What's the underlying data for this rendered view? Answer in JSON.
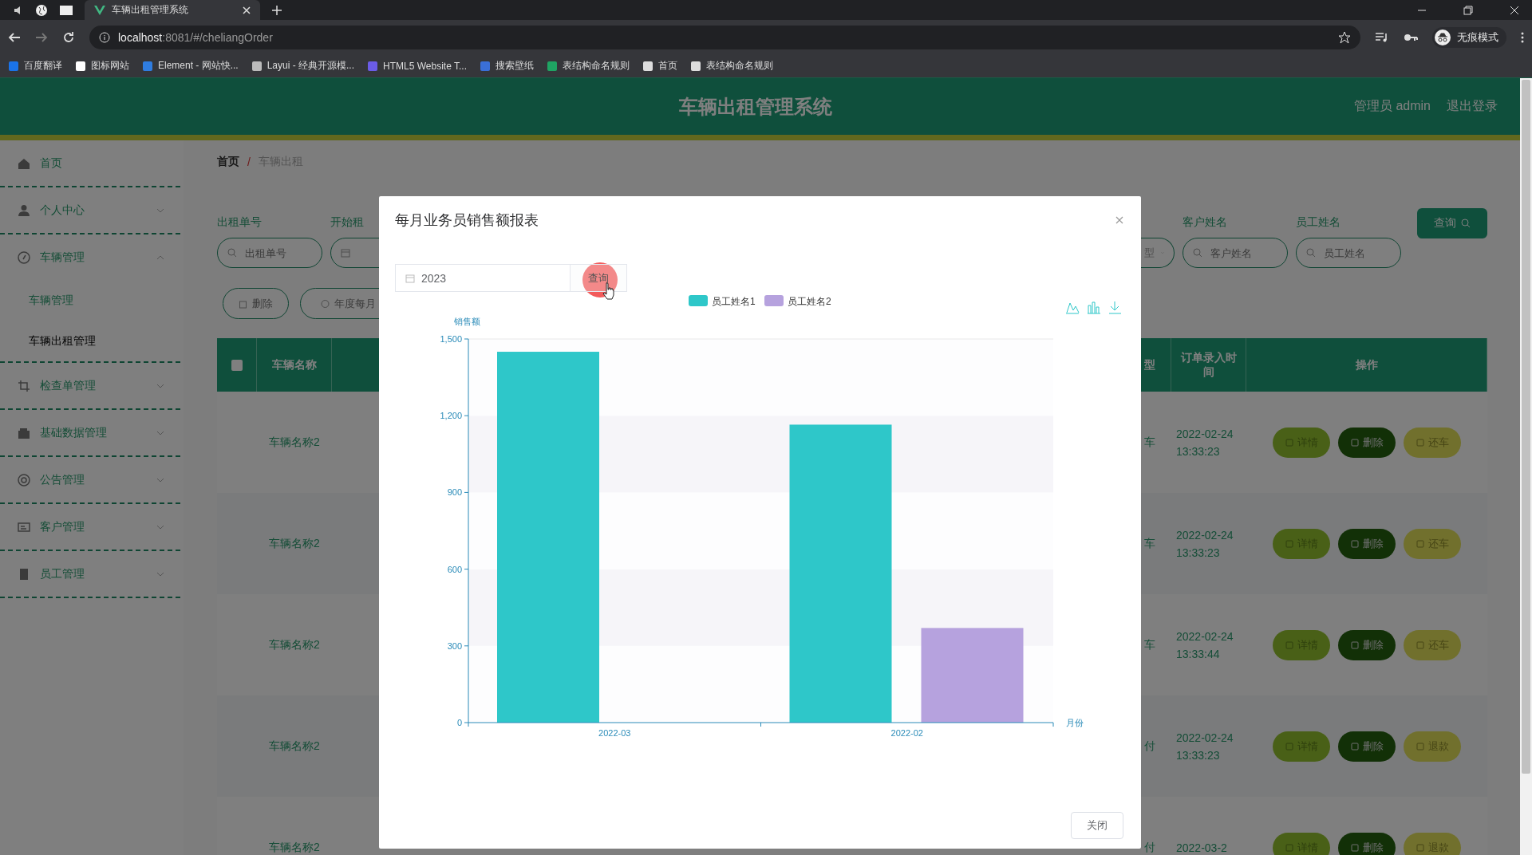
{
  "browser": {
    "tabs": [
      {
        "title": "车辆出租管理系统",
        "selected": true
      }
    ],
    "address": {
      "host": "localhost",
      "path": ":8081/#/cheliangOrder"
    },
    "profile": "无痕模式",
    "bookmarks": [
      "百度翻译",
      "图标网站",
      "Element - 网站快...",
      "Layui - 经典开源模...",
      "HTML5 Website T...",
      "搜索壁纸",
      "表结构命名规则",
      "首页",
      "表结构命名规则"
    ]
  },
  "header": {
    "title": "车辆出租管理系统",
    "user": "管理员 admin",
    "logout": "退出登录"
  },
  "sidebar": {
    "items": [
      {
        "label": "首页",
        "selected": false
      },
      {
        "label": "个人中心",
        "selected": false,
        "expanded": false
      },
      {
        "label": "车辆管理",
        "selected": false,
        "expanded": true,
        "children": [
          {
            "label": "车辆管理",
            "selected": false
          },
          {
            "label": "车辆出租管理",
            "selected": true
          }
        ]
      },
      {
        "label": "检查单管理",
        "selected": false,
        "expanded": false
      },
      {
        "label": "基础数据管理",
        "selected": false,
        "expanded": false
      },
      {
        "label": "公告管理",
        "selected": false,
        "expanded": false
      },
      {
        "label": "客户管理",
        "selected": false,
        "expanded": false
      },
      {
        "label": "员工管理",
        "selected": false,
        "expanded": false
      }
    ]
  },
  "breadcrumb": [
    "首页",
    "车辆出租"
  ],
  "breadcrumb_separator": "/",
  "filters": {
    "left": [
      {
        "kind": "search",
        "label": "出租单号",
        "placeholder": "出租单号"
      },
      {
        "kind": "date",
        "label": "开始租"
      }
    ],
    "right": [
      {
        "kind": "select",
        "value": "型"
      },
      {
        "kind": "search",
        "label": "客户姓名",
        "placeholder": "客户姓名"
      },
      {
        "kind": "search",
        "label": "员工姓名",
        "placeholder": "员工姓名"
      }
    ],
    "query_button": "查询"
  },
  "actions": [
    {
      "kind": "delete",
      "label": "删除"
    },
    {
      "kind": "stats",
      "label": "年度每月"
    }
  ],
  "table": {
    "header_checked": false,
    "columns": [
      "车辆名称",
      "型",
      "订单录入时间",
      "操作"
    ],
    "rows": [
      {
        "name": "车辆名称2",
        "type": "车",
        "time": "2022-02-24 13:33:23",
        "actions": [
          {
            "kind": "detail",
            "label": "详情"
          },
          {
            "kind": "delete",
            "label": "删除"
          },
          {
            "kind": "return",
            "label": "还车"
          }
        ]
      },
      {
        "name": "车辆名称2",
        "type": "车",
        "time": "2022-02-24 13:33:23",
        "actions": [
          {
            "kind": "detail",
            "label": "详情"
          },
          {
            "kind": "delete",
            "label": "删除"
          },
          {
            "kind": "return",
            "label": "还车"
          }
        ]
      },
      {
        "name": "车辆名称2",
        "type": "车",
        "time": "2022-02-24 13:33:44",
        "actions": [
          {
            "kind": "detail",
            "label": "详情"
          },
          {
            "kind": "delete",
            "label": "删除"
          },
          {
            "kind": "return",
            "label": "还车"
          }
        ]
      },
      {
        "name": "车辆名称2",
        "type": "付",
        "time": "2022-02-24 13:33:23",
        "actions": [
          {
            "kind": "detail",
            "label": "详情"
          },
          {
            "kind": "delete",
            "label": "删除"
          },
          {
            "kind": "refund",
            "label": "退款"
          }
        ]
      },
      {
        "name": "车辆名称2",
        "type": "付",
        "time": "2022-03-2",
        "actions": [
          {
            "kind": "detail",
            "label": "详情"
          },
          {
            "kind": "delete",
            "label": "删除"
          },
          {
            "kind": "refund",
            "label": "退款"
          }
        ]
      }
    ]
  },
  "modal": {
    "title": "每月业务员销售额报表",
    "year": "2023",
    "query_button": "查询",
    "close_button": "关闭",
    "chart_data": {
      "type": "bar",
      "legend": "top",
      "ylabel": "销售额",
      "xlabel": "月份",
      "categories": [
        "2022-03",
        "2022-02"
      ],
      "series": [
        {
          "name": "员工姓名1",
          "color": "#2ec7c9",
          "values": [
            1450,
            1165
          ]
        },
        {
          "name": "员工姓名2",
          "color": "#b6a2de",
          "values": [
            null,
            370
          ]
        }
      ],
      "ylim": [
        0,
        1500
      ],
      "yticks": [
        0,
        {
          "value": 300,
          "label": "300"
        },
        {
          "value": 600,
          "label": "600"
        },
        {
          "value": 900,
          "label": "900"
        },
        {
          "value": 1200,
          "label": "1,200"
        },
        {
          "value": 1500,
          "label": "1,500"
        }
      ]
    }
  }
}
